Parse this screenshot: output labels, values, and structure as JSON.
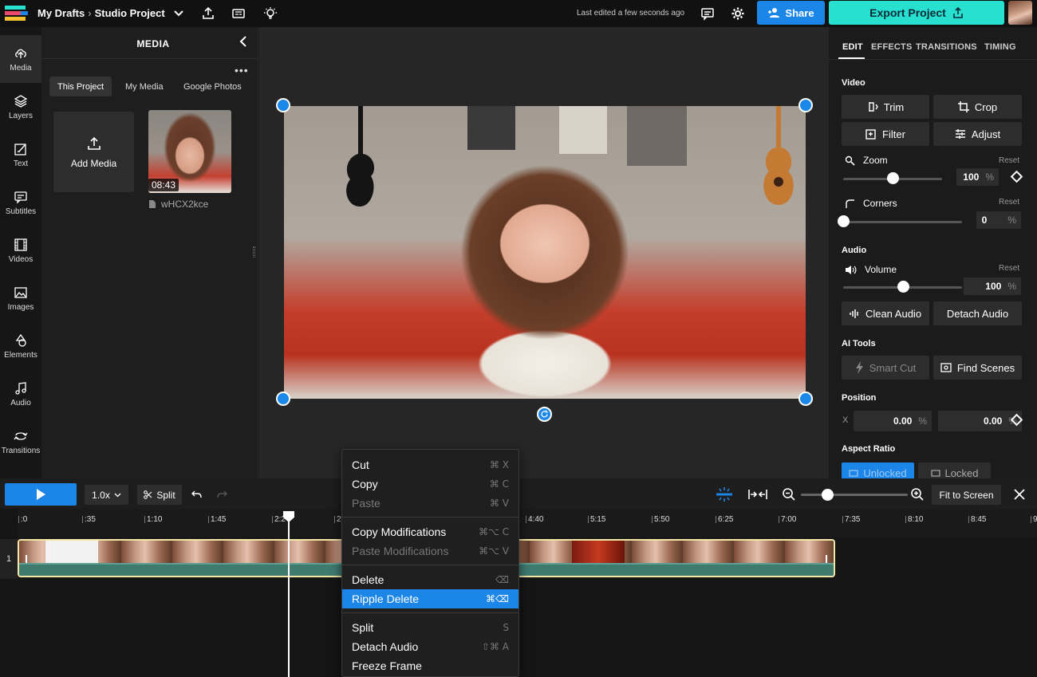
{
  "header": {
    "breadcrumb_root": "My Drafts",
    "breadcrumb_project": "Studio Project",
    "last_edited": "Last edited a few seconds ago",
    "share_label": "Share",
    "export_label": "Export Project"
  },
  "rail": {
    "items": [
      {
        "label": "Media"
      },
      {
        "label": "Layers"
      },
      {
        "label": "Text"
      },
      {
        "label": "Subtitles"
      },
      {
        "label": "Videos"
      },
      {
        "label": "Images"
      },
      {
        "label": "Elements"
      },
      {
        "label": "Audio"
      },
      {
        "label": "Transitions"
      }
    ]
  },
  "media": {
    "title": "MEDIA",
    "more": "•••",
    "tabs": [
      "This Project",
      "My Media",
      "Google Photos"
    ],
    "add_media": "Add Media",
    "thumb_duration": "08:43",
    "thumb_name": "wHCX2kce"
  },
  "right": {
    "tabs": [
      "EDIT",
      "EFFECTS",
      "TRANSITIONS",
      "TIMING"
    ],
    "video_heading": "Video",
    "trim": "Trim",
    "crop": "Crop",
    "filter": "Filter",
    "adjust": "Adjust",
    "zoom_label": "Zoom",
    "zoom_value": "100",
    "zoom_level": 0.5,
    "corners_label": "Corners",
    "corners_value": "0",
    "corners_level": 0,
    "audio_heading": "Audio",
    "volume_label": "Volume",
    "volume_value": "100",
    "volume_level": 0.5,
    "reset": "Reset",
    "percent": "%",
    "clean_audio": "Clean Audio",
    "detach_audio": "Detach Audio",
    "ai_heading": "AI Tools",
    "smart_cut": "Smart Cut",
    "find_scenes": "Find Scenes",
    "position_heading": "Position",
    "x_label": "X",
    "x_value": "0.00",
    "y_label": "Y",
    "y_value": "0.00",
    "aspect_heading": "Aspect Ratio",
    "unlocked": "Unlocked",
    "locked": "Locked"
  },
  "timeline": {
    "speed": "1.0x",
    "split": "Split",
    "fit_to_screen": "Fit to Screen",
    "track_number": "1",
    "ticks": [
      ":0",
      ":35",
      "1:10",
      "1:45",
      "2:2",
      "2",
      "4:40",
      "5:15",
      "5:50",
      "6:25",
      "7:00",
      "7:35",
      "8:10",
      "8:45",
      "9"
    ]
  },
  "context_menu": {
    "cut": "Cut",
    "cut_sc": "⌘ X",
    "copy": "Copy",
    "copy_sc": "⌘ C",
    "paste": "Paste",
    "paste_sc": "⌘ V",
    "copy_mod": "Copy Modifications",
    "copy_mod_sc": "⌘⌥ C",
    "paste_mod": "Paste Modifications",
    "paste_mod_sc": "⌘⌥ V",
    "delete": "Delete",
    "delete_sc": "⌫",
    "ripple_delete": "Ripple Delete",
    "ripple_delete_sc": "⌘⌫",
    "split": "Split",
    "split_sc": "S",
    "detach_audio": "Detach Audio",
    "detach_audio_sc": "⇧⌘ A",
    "freeze_frame": "Freeze Frame"
  },
  "colors": {
    "accent": "#1c86e8",
    "export": "#27e0d0",
    "clip_border": "#f3e7a8"
  }
}
